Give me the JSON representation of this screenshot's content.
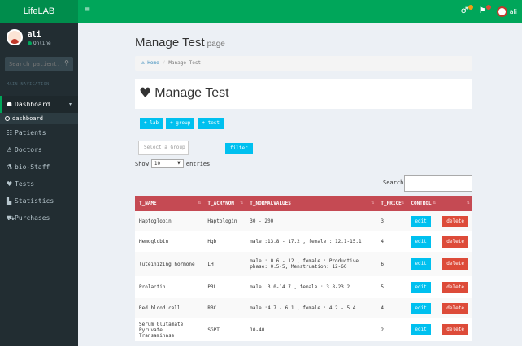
{
  "app": {
    "logo": "LifeLAB",
    "menu_toggle": "≡",
    "user_name": "ali"
  },
  "user_panel": {
    "name": "ali",
    "status": "Online"
  },
  "sidebar": {
    "search_placeholder": "Search patient...",
    "nav_header": "MAIN NAVIGATION",
    "items": [
      {
        "label": "Dashboard",
        "icon": "tachometer-icon"
      },
      {
        "label": "dashboard",
        "icon": "circle-icon"
      },
      {
        "label": "Patients",
        "icon": "users-icon"
      },
      {
        "label": "Doctors",
        "icon": "user-md-icon"
      },
      {
        "label": "bio-Staff",
        "icon": "flask-icon"
      },
      {
        "label": "Tests",
        "icon": "heartbeat-icon"
      },
      {
        "label": "Statistics",
        "icon": "chart-icon"
      },
      {
        "label": "Purchases",
        "icon": "cart-icon"
      }
    ]
  },
  "header": {
    "title": "Manage Test",
    "subtitle": "page",
    "breadcrumb_home": "Home",
    "breadcrumb_current": "Manage Test"
  },
  "box": {
    "title": "Manage Test"
  },
  "buttons": {
    "lab": "+ lab",
    "group": "+ group",
    "test": "+ test",
    "filter": "filter"
  },
  "filters": {
    "group_placeholder": "Select a Group",
    "show_label": "Show",
    "entries_value": "10",
    "entries_label": "entries",
    "search_label": "Search:"
  },
  "table": {
    "columns": [
      "T_NAME",
      "T_ACRYNOM",
      "T_NORMALVALUES",
      "T_PRICE",
      "CONTROL"
    ],
    "edit_label": "edit",
    "delete_label": "delete",
    "rows": [
      {
        "name": "Haptoglobin",
        "acronym": "Haptologin",
        "normal": "30 - 200",
        "price": "3"
      },
      {
        "name": "Hemoglobin",
        "acronym": "Hgb",
        "normal": "male :13.8 - 17.2 , female : 12.1-15.1",
        "price": "4"
      },
      {
        "name": "luteinizing hormone",
        "acronym": "LH",
        "normal": "male : 0.6 - 12 , female : Productive phase: 0.5-5, Menstruation: 12-60",
        "price": "6"
      },
      {
        "name": "Prolactin",
        "acronym": "PRL",
        "normal": "male: 3.0-14.7 , female : 3.8-23.2",
        "price": "5"
      },
      {
        "name": "Red blood cell",
        "acronym": "RBC",
        "normal": "male :4.7 - 6.1 , female : 4.2 - 5.4",
        "price": "4"
      },
      {
        "name": "Serum Glutamate Pyruvate Transaminase",
        "acronym": "SGPT",
        "normal": "10-40",
        "price": "2"
      }
    ]
  }
}
